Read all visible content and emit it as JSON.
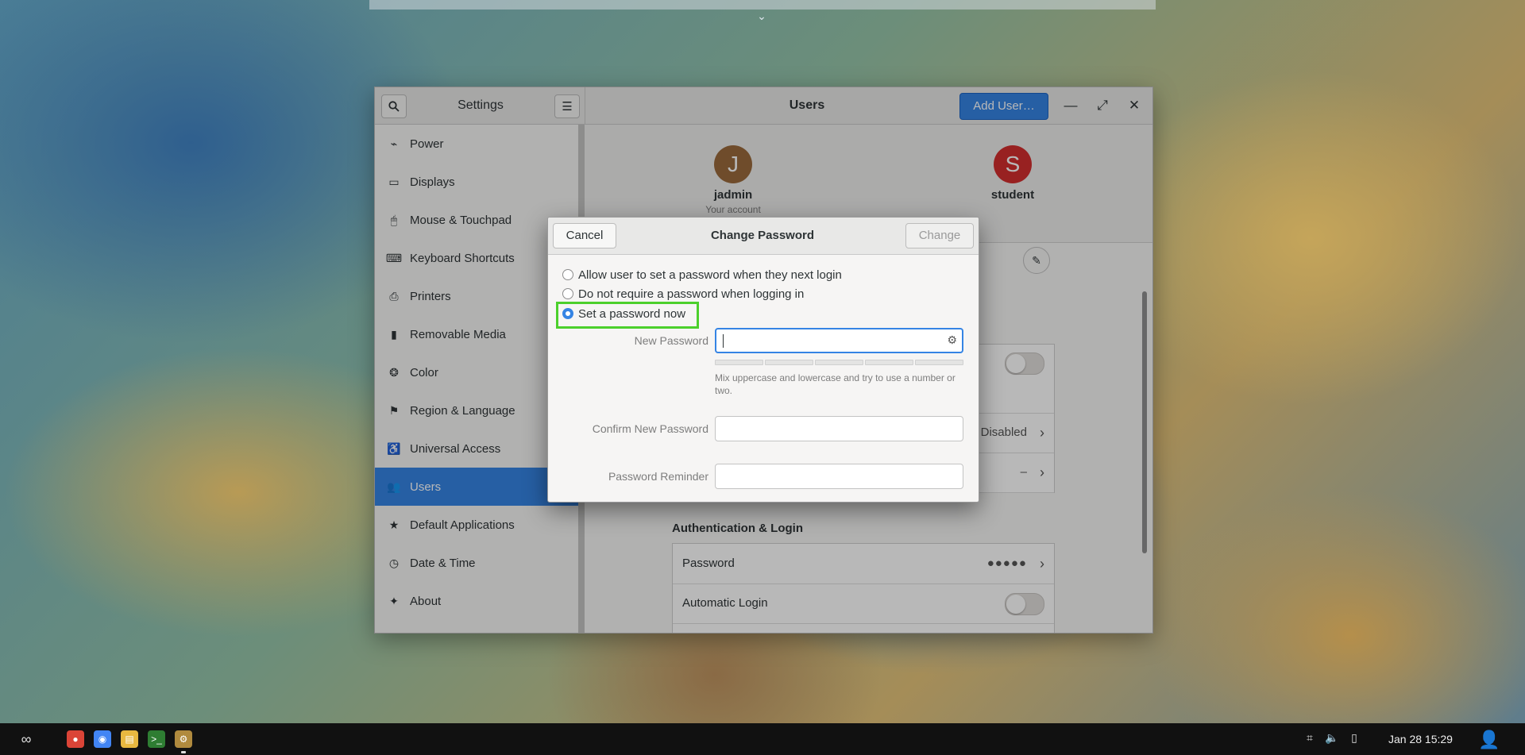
{
  "window": {
    "sidebar_title": "Settings",
    "panel_title": "Users",
    "add_user_label": "Add User…"
  },
  "sidebar": {
    "items": [
      {
        "label": "Power",
        "icon": "power-icon"
      },
      {
        "label": "Displays",
        "icon": "display-icon"
      },
      {
        "label": "Mouse & Touchpad",
        "icon": "mouse-icon"
      },
      {
        "label": "Keyboard Shortcuts",
        "icon": "keyboard-icon"
      },
      {
        "label": "Printers",
        "icon": "printer-icon"
      },
      {
        "label": "Removable Media",
        "icon": "usb-drive-icon"
      },
      {
        "label": "Color",
        "icon": "color-icon"
      },
      {
        "label": "Region & Language",
        "icon": "flag-icon"
      },
      {
        "label": "Universal Access",
        "icon": "accessibility-icon"
      },
      {
        "label": "Users",
        "icon": "users-icon",
        "active": true
      },
      {
        "label": "Default Applications",
        "icon": "star-icon"
      },
      {
        "label": "Date & Time",
        "icon": "clock-icon"
      },
      {
        "label": "About",
        "icon": "about-icon"
      }
    ]
  },
  "users": {
    "accounts": [
      {
        "initial": "J",
        "name": "jadmin",
        "subtitle": "Your account",
        "color": "#9a6a3c"
      },
      {
        "initial": "S",
        "name": "student",
        "subtitle": "",
        "color": "#d32f2f"
      }
    ],
    "rows_top": [
      {
        "value": "Disabled"
      },
      {
        "value": "–"
      }
    ],
    "auth_section_title": "Authentication & Login",
    "auth_rows": [
      {
        "label": "Password",
        "value": "●●●●●"
      },
      {
        "label": "Automatic Login"
      }
    ]
  },
  "dialog": {
    "cancel_label": "Cancel",
    "title": "Change Password",
    "change_label": "Change",
    "options": [
      {
        "label": "Allow user to set a password when they next login",
        "checked": false
      },
      {
        "label": "Do not require a password when logging in",
        "checked": false
      },
      {
        "label": "Set a password now",
        "checked": true
      }
    ],
    "new_password_label": "New Password",
    "new_password_value": "",
    "hint_text": "Mix uppercase and lowercase and try to use a number or two.",
    "confirm_label": "Confirm New Password",
    "confirm_value": "",
    "reminder_label": "Password Reminder",
    "reminder_value": ""
  },
  "taskbar": {
    "clock": "Jan 28  15:29"
  },
  "colors": {
    "accent": "#3584e4",
    "highlight": "#4cd02c"
  }
}
